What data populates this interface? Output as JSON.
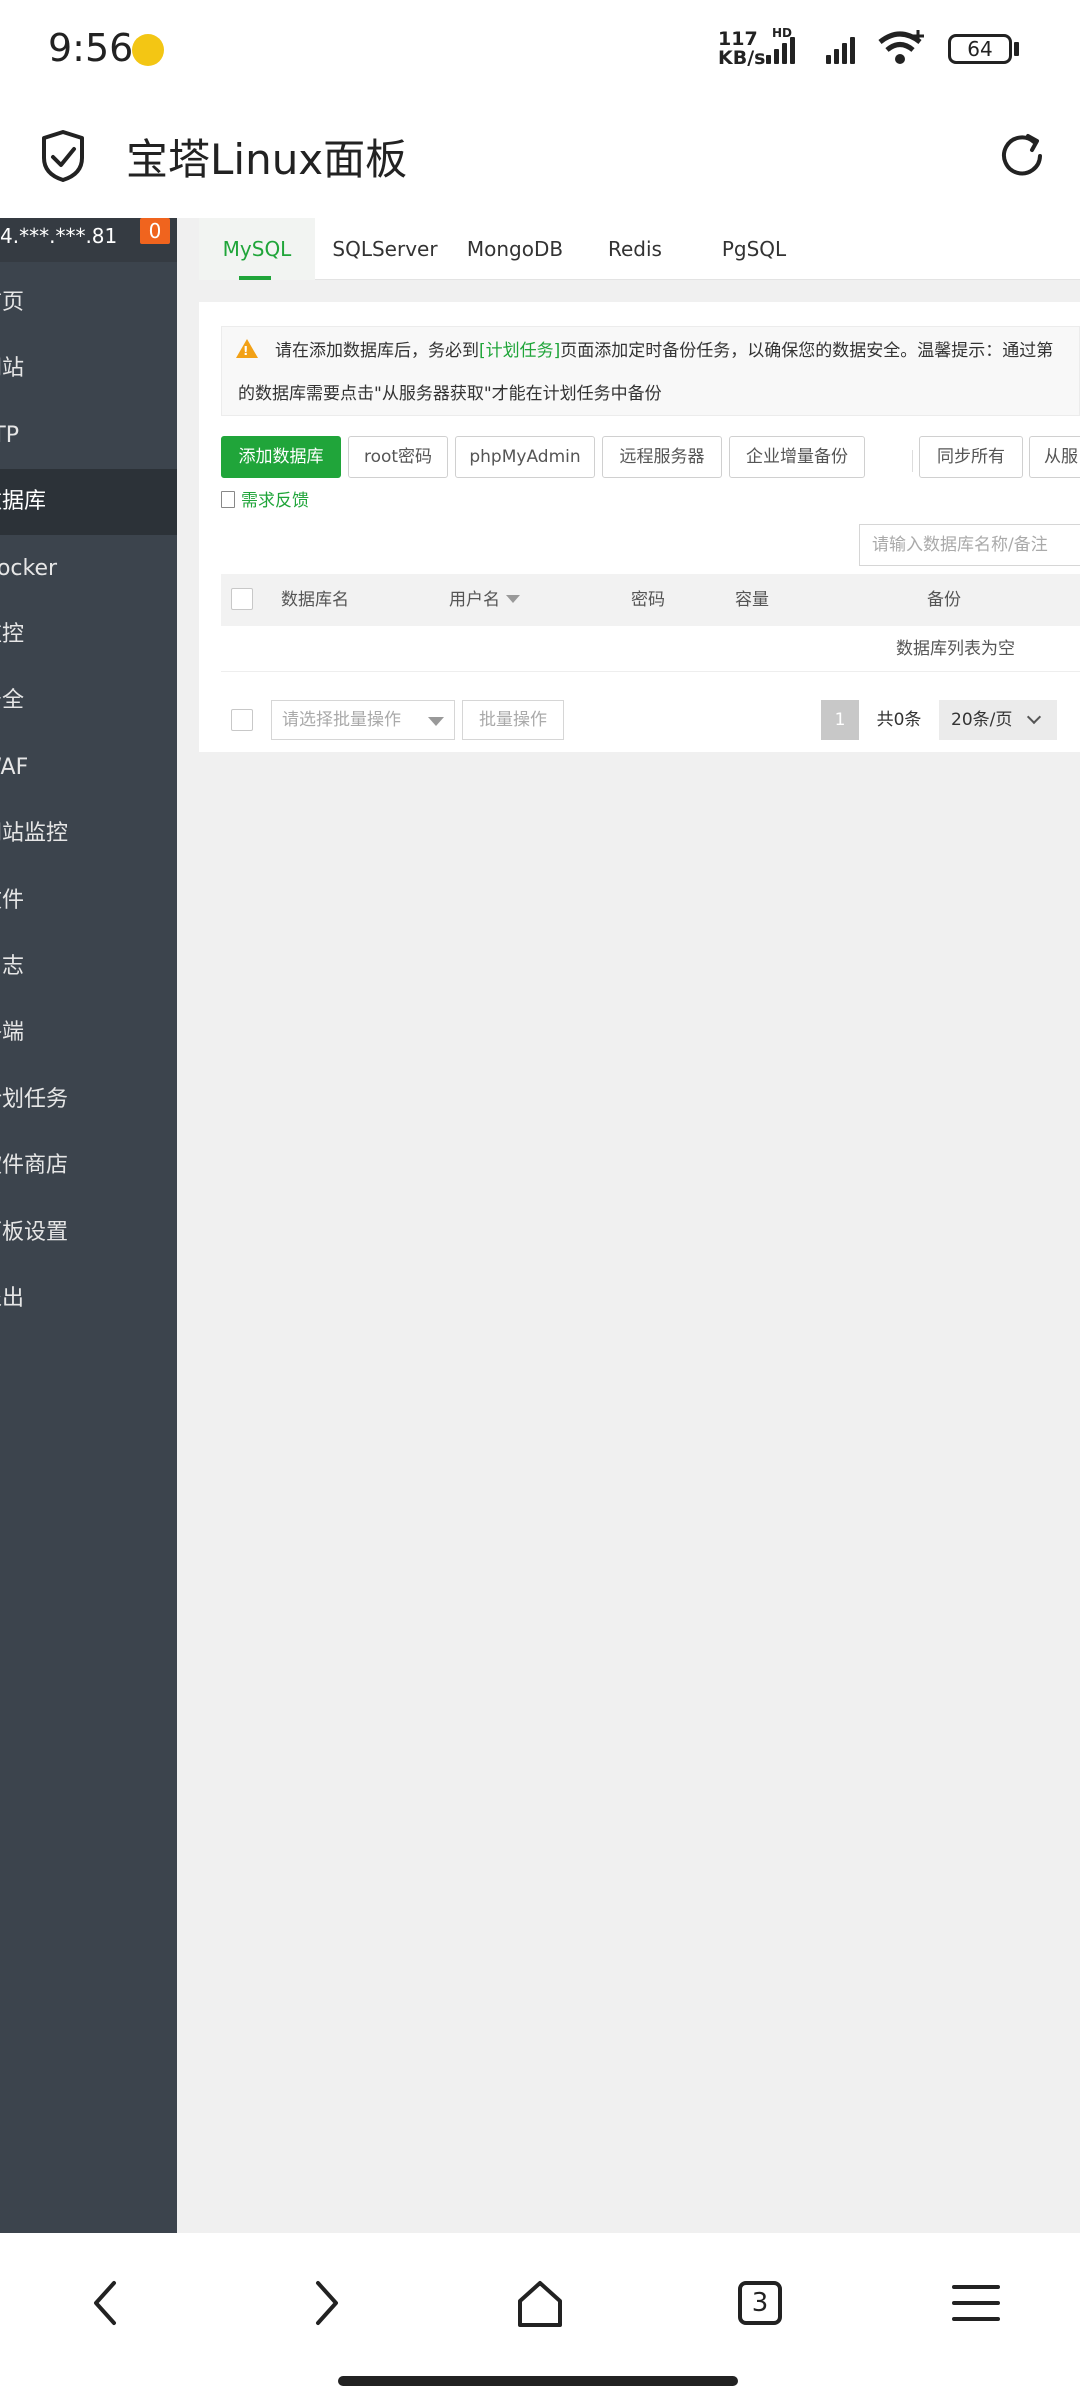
{
  "status_bar": {
    "time": "9:56",
    "net_speed_value": "117",
    "net_speed_unit": "KB/s",
    "network_label": "HD",
    "battery": "64"
  },
  "app_bar": {
    "title": "宝塔Linux面板"
  },
  "sidebar": {
    "server_ip": "4.***.***.81",
    "badge": "0",
    "items": [
      {
        "label": "首页"
      },
      {
        "label": "网站"
      },
      {
        "label": "FTP"
      },
      {
        "label": "数据库"
      },
      {
        "label": "Docker"
      },
      {
        "label": "监控"
      },
      {
        "label": "安全"
      },
      {
        "label": "WAF"
      },
      {
        "label": "网站监控"
      },
      {
        "label": "文件"
      },
      {
        "label": "日志"
      },
      {
        "label": "终端"
      },
      {
        "label": "计划任务"
      },
      {
        "label": "软件商店"
      },
      {
        "label": "面板设置"
      },
      {
        "label": "退出"
      }
    ],
    "active_index": 3
  },
  "tabs": [
    "MySQL",
    "SQLServer",
    "MongoDB",
    "Redis",
    "PgSQL"
  ],
  "notice": {
    "line1_a": "请在添加数据库后，务必到",
    "line1_link": "[计划任务]",
    "line1_b": "页面添加定时备份任务，以确保您的数据安全。温馨提示：通过第",
    "line2": "的数据库需要点击\"从服务器获取\"才能在计划任务中备份"
  },
  "toolbar": {
    "add_db": "添加数据库",
    "root_pwd": "root密码",
    "phpmyadmin": "phpMyAdmin",
    "remote_server": "远程服务器",
    "enterprise_backup": "企业增量备份",
    "sync_all": "同步所有",
    "from_server": "从服"
  },
  "feedback": "需求反馈",
  "search": {
    "placeholder": "请输入数据库名称/备注"
  },
  "table": {
    "columns": [
      "数据库名",
      "用户名",
      "密码",
      "容量",
      "备份"
    ],
    "empty_text": "数据库列表为空"
  },
  "footer": {
    "batch_placeholder": "请选择批量操作",
    "batch_button": "批量操作",
    "current_page": "1",
    "total": "共0条",
    "page_size": "20条/页"
  },
  "bottom_nav": {
    "tabs_count": "3"
  },
  "colors": {
    "accent": "#20a53a",
    "sidebar_bg": "#3c444d",
    "warning": "#f2a116",
    "badge": "#f0641e"
  }
}
